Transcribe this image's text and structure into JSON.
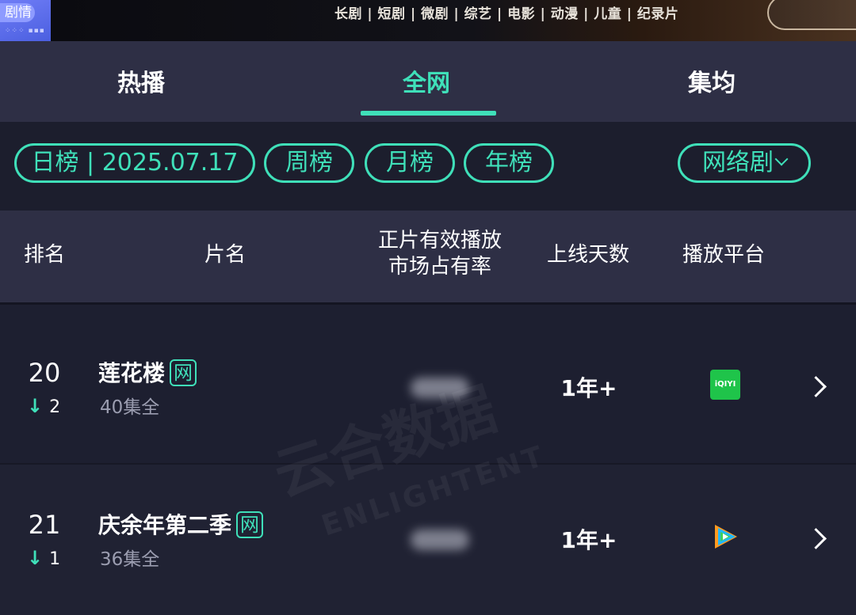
{
  "banner": {
    "left_label": "剧情",
    "categories": "长剧 | 短剧 | 微剧 | 综艺 | 电影 | 动漫 | 儿童 | 纪录片"
  },
  "tabs": [
    {
      "label": "热播",
      "active": false
    },
    {
      "label": "全网",
      "active": true
    },
    {
      "label": "集均",
      "active": false
    }
  ],
  "filters": {
    "daily": "日榜 | 2025.07.17",
    "weekly": "周榜",
    "monthly": "月榜",
    "yearly": "年榜",
    "genre": "网络剧"
  },
  "columns": {
    "rank": "排名",
    "title": "片名",
    "share_line1": "正片有效播放",
    "share_line2": "市场占有率",
    "days": "上线天数",
    "platform": "播放平台"
  },
  "rows": [
    {
      "rank": "20",
      "change": "2",
      "title": "莲花楼",
      "badge": "网",
      "episodes": "40集全",
      "days": "1年+",
      "platform_icon": "iqiyi-icon",
      "platform_text": "iQIYI"
    },
    {
      "rank": "21",
      "change": "1",
      "title": "庆余年第二季",
      "badge": "网",
      "episodes": "36集全",
      "days": "1年+",
      "platform_icon": "tencent-video-icon"
    }
  ],
  "watermark": {
    "main": "云合数据",
    "sub": "ENLIGHTENT"
  },
  "colors": {
    "accent": "#3fe0b9",
    "header_bg": "#2e2f45",
    "page_bg": "#1d1f30"
  }
}
